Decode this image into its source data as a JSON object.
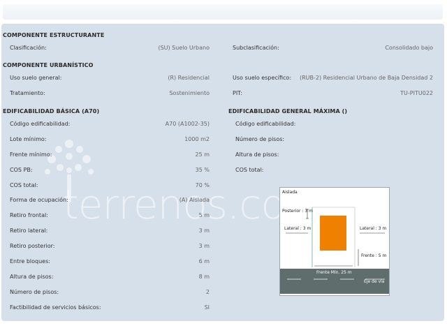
{
  "componente_estructurante": {
    "title": "COMPONENTE ESTRUCTURANTE",
    "clasificacion_label": "Clasificación:",
    "clasificacion_value": "(SU) Suelo Urbano",
    "subclasificacion_label": "Subclasificación:",
    "subclasificacion_value": "Consolidado bajo"
  },
  "componente_urbanistico": {
    "title": "COMPONENTE URBANÍSTICO",
    "uso_general_label": "Uso suelo general:",
    "uso_general_value": "(R) Residencial",
    "uso_especifico_label": "Uso suelo específico:",
    "uso_especifico_value": "(RUB-2) Residencial Urbano de Baja Densidad 2",
    "tratamiento_label": "Tratamiento:",
    "tratamiento_value": "Sostenimiento",
    "pit_label": "PIT:",
    "pit_value": "TU-PITU022"
  },
  "edificabilidad_basica": {
    "title": "EDIFICABILIDAD BÁSICA (A70)",
    "rows": [
      {
        "label": "Código edificabilidad:",
        "value": "A70 (A1002-35)"
      },
      {
        "label": "Lote mínimo:",
        "value": "1000 m2"
      },
      {
        "label": "Frente mínimo:",
        "value": "25 m"
      },
      {
        "label": "COS PB:",
        "value": "35 %"
      },
      {
        "label": "COS total:",
        "value": "70 %"
      },
      {
        "label": "Forma de ocupación:",
        "value": "(A) Aislada"
      },
      {
        "label": "Retiro frontal:",
        "value": "5 m"
      },
      {
        "label": "Retiro lateral:",
        "value": "3 m"
      },
      {
        "label": "Retiro posterior:",
        "value": "3 m"
      },
      {
        "label": "Entre bloques:",
        "value": "6 m"
      },
      {
        "label": "Altura de pisos:",
        "value": "8 m"
      },
      {
        "label": "Número de pisos:",
        "value": "2"
      },
      {
        "label": "Factibilidad de servicios básicos:",
        "value": "SI"
      }
    ]
  },
  "edificabilidad_general": {
    "title": "EDIFICABILIDAD GENERAL MÁXIMA ()",
    "rows": [
      {
        "label": "Código edificabilidad:"
      },
      {
        "label": "Número de pisos:"
      },
      {
        "label": "Altura de pisos:"
      },
      {
        "label": "COS total:"
      }
    ]
  },
  "diagram": {
    "title": "Aislada",
    "posterior": "Posterior : 3 m",
    "lateral_left": "Lateral : 3 m",
    "lateral_right": "Lateral : 3 m",
    "frente": "Frente : 5 m",
    "frente_min": "Frente Mín. 25 m",
    "eje_via": "Eje de vía",
    "building_color": "#f08000",
    "road_color": "#5f6e6c"
  },
  "watermark": "terrenos.com.ec"
}
